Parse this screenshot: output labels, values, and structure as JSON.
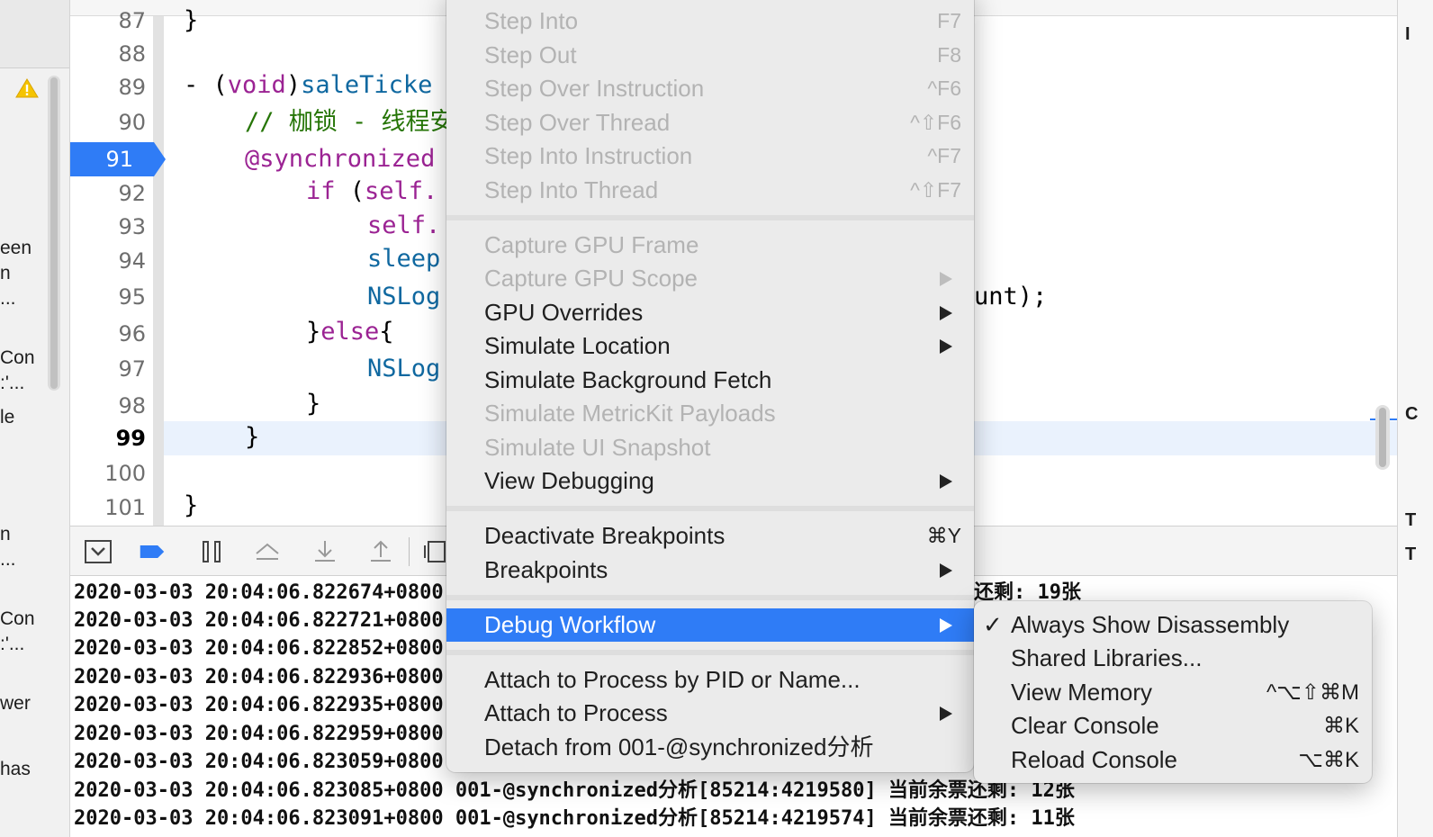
{
  "left_fragments": [
    "een",
    "n",
    "...",
    "Con",
    ":'...",
    "le",
    "n",
    "...",
    "Con",
    ":'...",
    "wer",
    "has"
  ],
  "editor": {
    "line_numbers": [
      "87",
      "88",
      "89",
      "90",
      "91",
      "92",
      "93",
      "94",
      "95",
      "96",
      "97",
      "98",
      "99",
      "100",
      "101"
    ],
    "breakpoint_line": "91",
    "current_line": "99",
    "code": {
      "l87": "}",
      "l89_a": "- (",
      "l89_kw": "void",
      "l89_b": ")",
      "l89_fn": "saleTicke",
      "l90": "// 枷锁 - 线程安",
      "l91": "@synchronized",
      "l92_kw": "if",
      "l92_b": " (",
      "l92_c": "self.",
      "l93": "self.",
      "l94": "sleep",
      "l95": "NSLog",
      "l95_tail": "unt);",
      "l96_a": "}",
      "l96_kw": "else",
      "l96_b": "{",
      "l97": "NSLog",
      "l98": "}",
      "l99": "}",
      "l101": "}"
    }
  },
  "console": {
    "prefixes": [
      "2020-03-03 20:04:06.822674+0800",
      "2020-03-03 20:04:06.822721+0800",
      "2020-03-03 20:04:06.822852+0800",
      "2020-03-03 20:04:06.822936+0800",
      "2020-03-03 20:04:06.822935+0800",
      "2020-03-03 20:04:06.822959+0800",
      "2020-03-03 20:04:06.823059+0800",
      "2020-03-03 20:04:06.823085+0800 001-@synchronized分析[85214:4219580] 当前余票还剩: 12张",
      "2020-03-03 20:04:06.823091+0800 001-@synchronized分析[85214:4219574] 当前余票还剩: 11张"
    ],
    "first_tail": "还剩: 19张"
  },
  "menu": {
    "items": [
      {
        "label": "Step Into",
        "shortcut": "F7",
        "disabled": true
      },
      {
        "label": "Step Out",
        "shortcut": "F8",
        "disabled": true
      },
      {
        "label": "Step Over Instruction",
        "shortcut": "^F6",
        "disabled": true
      },
      {
        "label": "Step Over Thread",
        "shortcut": "^⇧F6",
        "disabled": true
      },
      {
        "label": "Step Into Instruction",
        "shortcut": "^F7",
        "disabled": true
      },
      {
        "label": "Step Into Thread",
        "shortcut": "^⇧F7",
        "disabled": true
      },
      {
        "label": "Capture GPU Frame",
        "disabled": true
      },
      {
        "label": "Capture GPU Scope",
        "submenu": true,
        "disabled": true
      },
      {
        "label": "GPU Overrides",
        "submenu": true
      },
      {
        "label": "Simulate Location",
        "submenu": true
      },
      {
        "label": "Simulate Background Fetch"
      },
      {
        "label": "Simulate MetricKit Payloads",
        "disabled": true
      },
      {
        "label": "Simulate UI Snapshot",
        "disabled": true
      },
      {
        "label": "View Debugging",
        "submenu": true
      },
      {
        "label": "Deactivate Breakpoints",
        "shortcut": "⌘Y"
      },
      {
        "label": "Breakpoints",
        "submenu": true
      },
      {
        "label": "Debug Workflow",
        "submenu": true,
        "selected": true
      },
      {
        "label": "Attach to Process by PID or Name..."
      },
      {
        "label": "Attach to Process",
        "submenu": true
      },
      {
        "label": "Detach from 001-@synchronized分析"
      }
    ]
  },
  "submenu": {
    "items": [
      {
        "label": "Always Show Disassembly",
        "checked": true,
        "check": "✓"
      },
      {
        "label": "Shared Libraries..."
      },
      {
        "label": "View Memory",
        "shortcut": "^⌥⇧⌘M"
      },
      {
        "label": "Clear Console",
        "shortcut": "⌘K"
      },
      {
        "label": "Reload Console",
        "shortcut": "⌥⌘K"
      }
    ]
  },
  "right_fragments": [
    "I",
    "C",
    "T",
    "T"
  ]
}
